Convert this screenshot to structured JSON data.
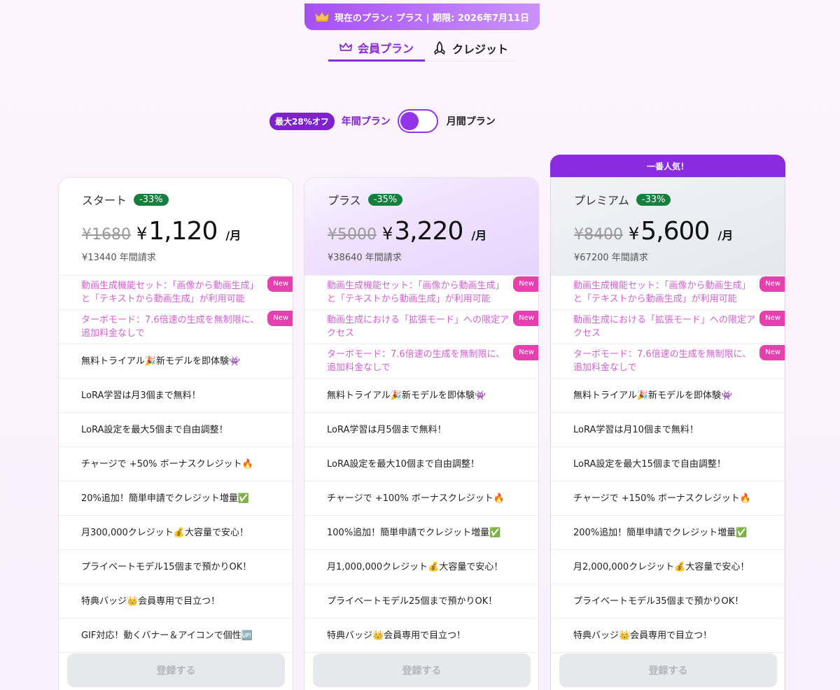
{
  "banner": {
    "text": "現在のプラン: プラス | 期限: 2026年7月11日"
  },
  "tabs": [
    {
      "label": "会員プラン",
      "active": true
    },
    {
      "label": "クレジット",
      "active": false
    }
  ],
  "billing_toggle": {
    "discount": "最大28%オフ",
    "yearly_label": "年間プラン",
    "monthly_label": "月間プラン",
    "selected": "yearly"
  },
  "popular_label": "一番人気！",
  "subscribe_label": "登録する",
  "new_label": "New",
  "colors": {
    "accent": "#8a2be2",
    "discount_green": "#15803d",
    "new_pink": "#e83fb0"
  },
  "plans": [
    {
      "name": "スタート",
      "off": "-33%",
      "old_price": "¥1680",
      "yen": "¥",
      "price": "1,120",
      "per": "/月",
      "annual": "¥13440 年間請求",
      "features": [
        {
          "text": "動画生成機能セット：「画像から動画生成」と「テキストから動画生成」が利用可能",
          "new": true
        },
        {
          "text": "ターボモード：7.6倍速の生成を無制限に、追加料金なしで",
          "new": true
        },
        {
          "text": "無料トライアル🎉新モデルを即体験👾",
          "new": false
        },
        {
          "text": "LoRA学習は月3個まで無料！",
          "new": false
        },
        {
          "text": "LoRA設定を最大5個まで自由調整！",
          "new": false
        },
        {
          "text": "チャージで +50% ボーナスクレジット🔥",
          "new": false
        },
        {
          "text": "20%追加！簡単申請でクレジット増量✅",
          "new": false
        },
        {
          "text": "月300,000クレジット💰大容量で安心！",
          "new": false
        },
        {
          "text": "プライベートモデル15個まで預かりOK！",
          "new": false
        },
        {
          "text": "特典バッジ👑会員専用で目立つ！",
          "new": false
        },
        {
          "text": "GIF対応！動くバナー＆アイコンで個性🆙",
          "new": false
        }
      ]
    },
    {
      "name": "プラス",
      "off": "-35%",
      "old_price": "¥5000",
      "yen": "¥",
      "price": "3,220",
      "per": "/月",
      "annual": "¥38640 年間請求",
      "features": [
        {
          "text": "動画生成機能セット：「画像から動画生成」と「テキストから動画生成」が利用可能",
          "new": true
        },
        {
          "text": "動画生成における「拡張モード」への限定アクセス",
          "new": true
        },
        {
          "text": "ターボモード：7.6倍速の生成を無制限に、追加料金なしで",
          "new": true
        },
        {
          "text": "無料トライアル🎉新モデルを即体験👾",
          "new": false
        },
        {
          "text": "LoRA学習は月5個まで無料！",
          "new": false
        },
        {
          "text": "LoRA設定を最大10個まで自由調整！",
          "new": false
        },
        {
          "text": "チャージで +100% ボーナスクレジット🔥",
          "new": false
        },
        {
          "text": "100%追加！簡単申請でクレジット増量✅",
          "new": false
        },
        {
          "text": "月1,000,000クレジット💰大容量で安心！",
          "new": false
        },
        {
          "text": "プライベートモデル25個まで預かりOK！",
          "new": false
        },
        {
          "text": "特典バッジ👑会員専用で目立つ！",
          "new": false
        }
      ]
    },
    {
      "name": "プレミアム",
      "off": "-33%",
      "old_price": "¥8400",
      "yen": "¥",
      "price": "5,600",
      "per": "/月",
      "annual": "¥67200 年間請求",
      "features": [
        {
          "text": "動画生成機能セット：「画像から動画生成」と「テキストから動画生成」が利用可能",
          "new": true
        },
        {
          "text": "動画生成における「拡張モード」への限定アクセス",
          "new": true
        },
        {
          "text": "ターボモード：7.6倍速の生成を無制限に、追加料金なしで",
          "new": true
        },
        {
          "text": "無料トライアル🎉新モデルを即体験👾",
          "new": false
        },
        {
          "text": "LoRA学習は月10個まで無料！",
          "new": false
        },
        {
          "text": "LoRA設定を最大15個まで自由調整！",
          "new": false
        },
        {
          "text": "チャージで +150% ボーナスクレジット🔥",
          "new": false
        },
        {
          "text": "200%追加！簡単申請でクレジット増量✅",
          "new": false
        },
        {
          "text": "月2,000,000クレジット💰大容量で安心！",
          "new": false
        },
        {
          "text": "プライベートモデル35個まで預かりOK！",
          "new": false
        },
        {
          "text": "特典バッジ👑会員専用で目立つ！",
          "new": false
        }
      ]
    }
  ]
}
